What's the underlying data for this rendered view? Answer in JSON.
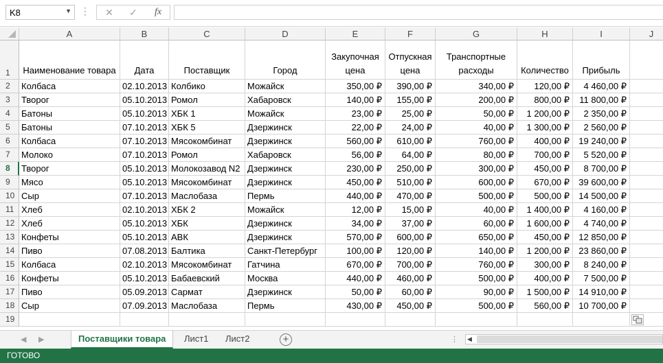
{
  "name_box": "K8",
  "formula_value": "",
  "columns": [
    "A",
    "B",
    "C",
    "D",
    "E",
    "F",
    "G",
    "H",
    "I",
    "J"
  ],
  "header_row": [
    "Наименование товара",
    "Дата",
    "Поставщик",
    "Город",
    "Закупочная цена",
    "Отпускная цена",
    "Транспортные расходы",
    "Количество",
    "Прибыль"
  ],
  "rows": [
    [
      "Колбаса",
      "02.10.2013",
      "Колбико",
      "Можайск",
      "350,00 ₽",
      "390,00 ₽",
      "340,00 ₽",
      "120,00 ₽",
      "4 460,00 ₽"
    ],
    [
      "Творог",
      "05.10.2013",
      "Ромол",
      "Хабаровск",
      "140,00 ₽",
      "155,00 ₽",
      "200,00 ₽",
      "800,00 ₽",
      "11 800,00 ₽"
    ],
    [
      "Батоны",
      "05.10.2013",
      "ХБК 1",
      "Можайск",
      "23,00 ₽",
      "25,00 ₽",
      "50,00 ₽",
      "1 200,00 ₽",
      "2 350,00 ₽"
    ],
    [
      "Батоны",
      "07.10.2013",
      "ХБК 5",
      "Дзержинск",
      "22,00 ₽",
      "24,00 ₽",
      "40,00 ₽",
      "1 300,00 ₽",
      "2 560,00 ₽"
    ],
    [
      "Колбаса",
      "07.10.2013",
      "Мясокомбинат",
      "Дзержинск",
      "560,00 ₽",
      "610,00 ₽",
      "760,00 ₽",
      "400,00 ₽",
      "19 240,00 ₽"
    ],
    [
      "Молоко",
      "07.10.2013",
      "Ромол",
      "Хабаровск",
      "56,00 ₽",
      "64,00 ₽",
      "80,00 ₽",
      "700,00 ₽",
      "5 520,00 ₽"
    ],
    [
      "Творог",
      "05.10.2013",
      "Молокозавод N2",
      "Дзержинск",
      "230,00 ₽",
      "250,00 ₽",
      "300,00 ₽",
      "450,00 ₽",
      "8 700,00 ₽"
    ],
    [
      "Мясо",
      "05.10.2013",
      "Мясокомбинат",
      "Дзержинск",
      "450,00 ₽",
      "510,00 ₽",
      "600,00 ₽",
      "670,00 ₽",
      "39 600,00 ₽"
    ],
    [
      "Сыр",
      "07.10.2013",
      "Маслобаза",
      "Пермь",
      "440,00 ₽",
      "470,00 ₽",
      "500,00 ₽",
      "500,00 ₽",
      "14 500,00 ₽"
    ],
    [
      "Хлеб",
      "02.10.2013",
      "ХБК 2",
      "Можайск",
      "12,00 ₽",
      "15,00 ₽",
      "40,00 ₽",
      "1 400,00 ₽",
      "4 160,00 ₽"
    ],
    [
      "Хлеб",
      "05.10.2013",
      "ХБК",
      "Дзержинск",
      "34,00 ₽",
      "37,00 ₽",
      "60,00 ₽",
      "1 600,00 ₽",
      "4 740,00 ₽"
    ],
    [
      "Конфеты",
      "05.10.2013",
      "АВК",
      "Дзержинск",
      "570,00 ₽",
      "600,00 ₽",
      "650,00 ₽",
      "450,00 ₽",
      "12 850,00 ₽"
    ],
    [
      "Пиво",
      "07.08.2013",
      "Балтика",
      "Санкт-Петербург",
      "100,00 ₽",
      "120,00 ₽",
      "140,00 ₽",
      "1 200,00 ₽",
      "23 860,00 ₽"
    ],
    [
      "Колбаса",
      "02.10.2013",
      "Мясокомбинат",
      "Гатчина",
      "670,00 ₽",
      "700,00 ₽",
      "760,00 ₽",
      "300,00 ₽",
      "8 240,00 ₽"
    ],
    [
      "Конфеты",
      "05.10.2013",
      "Бабаевский",
      "Москва",
      "440,00 ₽",
      "460,00 ₽",
      "500,00 ₽",
      "400,00 ₽",
      "7 500,00 ₽"
    ],
    [
      "Пиво",
      "05.09.2013",
      "Сармат",
      "Дзержинск",
      "50,00 ₽",
      "60,00 ₽",
      "90,00 ₽",
      "1 500,00 ₽",
      "14 910,00 ₽"
    ],
    [
      "Сыр",
      "07.09.2013",
      "Маслобаза",
      "Пермь",
      "430,00 ₽",
      "450,00 ₽",
      "500,00 ₽",
      "560,00 ₽",
      "10 700,00 ₽"
    ]
  ],
  "row_numbers": [
    "1",
    "2",
    "3",
    "4",
    "5",
    "6",
    "7",
    "8",
    "9",
    "10",
    "11",
    "12",
    "13",
    "14",
    "15",
    "16",
    "17",
    "18",
    "19"
  ],
  "selected_row": "8",
  "sheets": [
    "Поставщики товара",
    "Лист1",
    "Лист2"
  ],
  "active_sheet": "Поставщики товара",
  "status": "ГОТОВО",
  "icons": {
    "cancel": "✕",
    "enter": "✓",
    "function": "fx",
    "add_sheet": "⊕"
  },
  "colors": {
    "accent": "#217346",
    "grid": "#d4d4d4",
    "header_bg": "#f3f3f3"
  }
}
